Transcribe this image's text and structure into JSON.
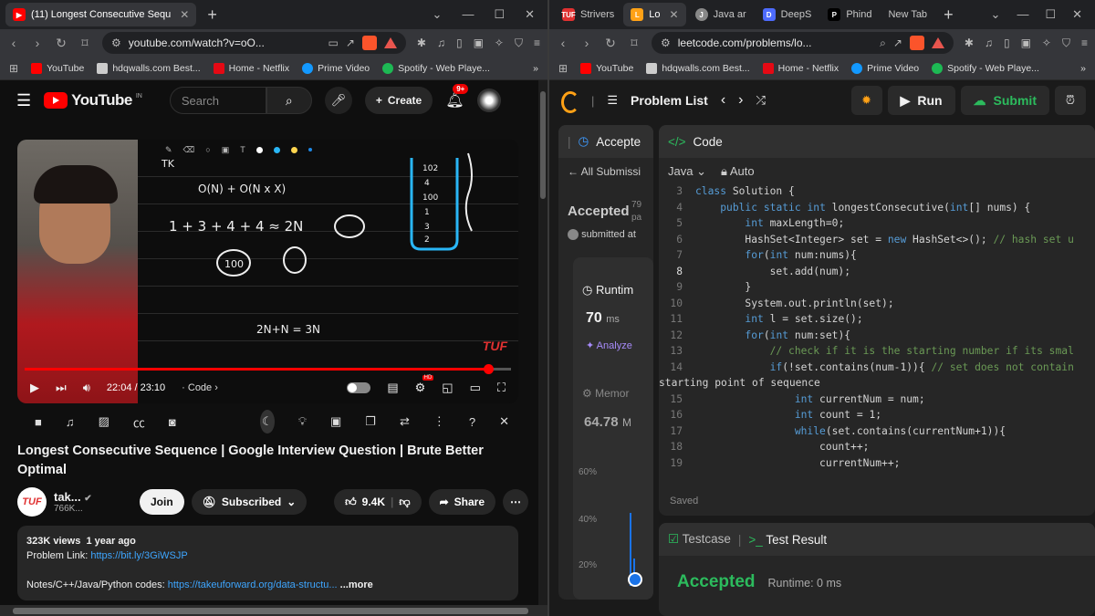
{
  "left_browser": {
    "tabs": [
      {
        "label": "(11) Longest Consecutive Sequ",
        "active": true,
        "fav_color": "#ff0000"
      }
    ],
    "address": "youtube.com/watch?v=oO...",
    "bookmarks": [
      {
        "label": "YouTube",
        "color": "#ff0000"
      },
      {
        "label": "hdqwalls.com Best...",
        "color": "#cccccc"
      },
      {
        "label": "Home - Netflix",
        "color": "#e50914"
      },
      {
        "label": "Prime Video",
        "color": "#1399ff"
      },
      {
        "label": "Spotify - Web Playe...",
        "color": "#1db954"
      }
    ]
  },
  "youtube": {
    "logo_text": "YouTube",
    "region": "IN",
    "search_placeholder": "Search",
    "create_label": "Create",
    "notif_count": "9+",
    "video": {
      "watermark": "TUF",
      "time": "22:04 / 23:10",
      "chapter": "Code",
      "progress": 0.953
    },
    "title": "Longest Consecutive Sequence | Google Interview Question | Brute Better Optimal",
    "channel": {
      "name": "tak...",
      "subs": "766K...",
      "logo": "TUF"
    },
    "join_label": "Join",
    "subscribed_label": "Subscribed",
    "likes": "9.4K",
    "share_label": "Share",
    "views": "323K views",
    "age": "1 year ago",
    "problem_link_label": "Problem Link:",
    "problem_link": "https://bit.ly/3GiWSJP",
    "notes_label": "Notes/C++/Java/Python codes:",
    "notes_link": "https://takeuforward.org/data-structu...",
    "more_label": "...more",
    "board_text": [
      "TK",
      "O(N) + O(N x X)",
      "1 + 3 + 4 + 4 ≈ 2N",
      "100",
      "2N+N = 3N"
    ]
  },
  "right_browser": {
    "tabs": [
      {
        "label": "Strivers",
        "fav_color": "#e03131",
        "fav": "TUF"
      },
      {
        "label": "Lo",
        "active": true,
        "fav_color": "#ffa116",
        "fav": "L"
      },
      {
        "label": "Java ar",
        "fav_color": "#888888",
        "fav": "J"
      },
      {
        "label": "DeepS",
        "fav_color": "#4d6bfe",
        "fav": "D"
      },
      {
        "label": "Phind",
        "fav_color": "#000000",
        "fav": "P"
      },
      {
        "label": "New Tab",
        "fav_color": "#35363a",
        "fav": ""
      }
    ],
    "address": "leetcode.com/problems/lo...",
    "bookmarks": [
      {
        "label": "YouTube",
        "color": "#ff0000"
      },
      {
        "label": "hdqwalls.com Best...",
        "color": "#cccccc"
      },
      {
        "label": "Home - Netflix",
        "color": "#e50914"
      },
      {
        "label": "Prime Video",
        "color": "#1399ff"
      },
      {
        "label": "Spotify - Web Playe...",
        "color": "#1db954"
      }
    ]
  },
  "leetcode": {
    "problem_list": "Problem List",
    "run": "Run",
    "submit": "Submit",
    "left_tab": "Accepte",
    "all_submissions": "All Submissi",
    "accepted": "Accepted",
    "submitted": "submitted at",
    "side_num": "79",
    "side_pa": "pa",
    "runtime_label": "Runtim",
    "runtime_value": "70",
    "runtime_unit": "ms",
    "analyze": "Analyze",
    "memory_label": "Memor",
    "memory_value": "64.78",
    "memory_unit": "M",
    "yticks": [
      "60%",
      "40%",
      "20%"
    ],
    "code_title": "Code",
    "language": "Java",
    "auto": "Auto",
    "saved": "Saved",
    "testcase": "Testcase",
    "test_result": "Test Result",
    "result_status": "Accepted",
    "result_runtime": "Runtime: 0 ms",
    "code_lines": [
      {
        "n": "3",
        "t": "class Solution {"
      },
      {
        "n": "4",
        "t": "    public static int longestConsecutive(int[] nums) {"
      },
      {
        "n": "5",
        "t": "        int maxLength=0;"
      },
      {
        "n": "6",
        "t": "        HashSet<Integer> set = new HashSet<>(); // hash set u"
      },
      {
        "n": "7",
        "t": "        for(int num:nums){"
      },
      {
        "n": "8",
        "t": "            set.add(num);"
      },
      {
        "n": "9",
        "t": "        }"
      },
      {
        "n": "10",
        "t": "        System.out.println(set);"
      },
      {
        "n": "11",
        "t": "        int l = set.size();"
      },
      {
        "n": "12",
        "t": "        for(int num:set){"
      },
      {
        "n": "13",
        "t": "            // check if it is the starting number if its smal"
      },
      {
        "n": "14",
        "t": "            if(!set.contains(num-1)){ // set does not contain"
      },
      {
        "n": "",
        "t": "starting point of sequence"
      },
      {
        "n": "15",
        "t": "                int currentNum = num;"
      },
      {
        "n": "16",
        "t": "                int count = 1;"
      },
      {
        "n": "17",
        "t": "                while(set.contains(currentNum+1)){"
      },
      {
        "n": "18",
        "t": "                    count++;"
      },
      {
        "n": "19",
        "t": "                    currentNum++;"
      }
    ]
  }
}
